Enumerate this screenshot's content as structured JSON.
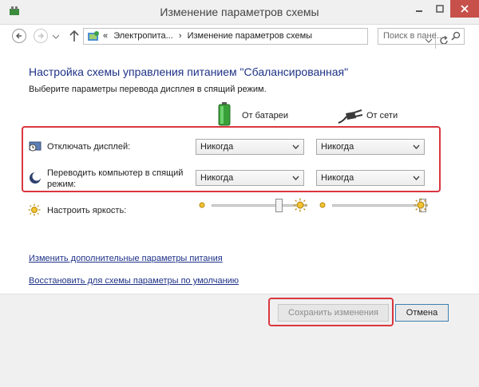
{
  "window": {
    "title": "Изменение параметров схемы"
  },
  "address_bar": {
    "prefix": "«",
    "crumbs": [
      "Электропита...",
      "Изменение параметров схемы"
    ],
    "separator": "›",
    "search_placeholder": "Поиск в пане..."
  },
  "content": {
    "heading": "Настройка схемы управления питанием \"Сбалансированная\"",
    "subtitle": "Выберите параметры перевода дисплея в спящий режим.",
    "columns": {
      "battery": "От батареи",
      "plugged": "От сети"
    },
    "rows": {
      "display_off": {
        "label": "Отключать дисплей:",
        "battery_value": "Никогда",
        "plugged_value": "Никогда"
      },
      "sleep": {
        "label_line1": "Переводить компьютер в спящий",
        "label_line2": "режим:",
        "battery_value": "Никогда",
        "plugged_value": "Никогда"
      },
      "brightness": {
        "label": "Настроить яркость:",
        "battery_level": 0.72,
        "plugged_level": 0.98
      }
    },
    "links": {
      "advanced": "Изменить дополнительные параметры питания",
      "restore": "Восстановить для схемы параметры по умолчанию"
    }
  },
  "footer": {
    "save_label": "Сохранить изменения",
    "cancel_label": "Отмена"
  },
  "colors": {
    "accent_text": "#1e3287",
    "highlight": "#d9363e",
    "close_button": "#c7504b"
  }
}
